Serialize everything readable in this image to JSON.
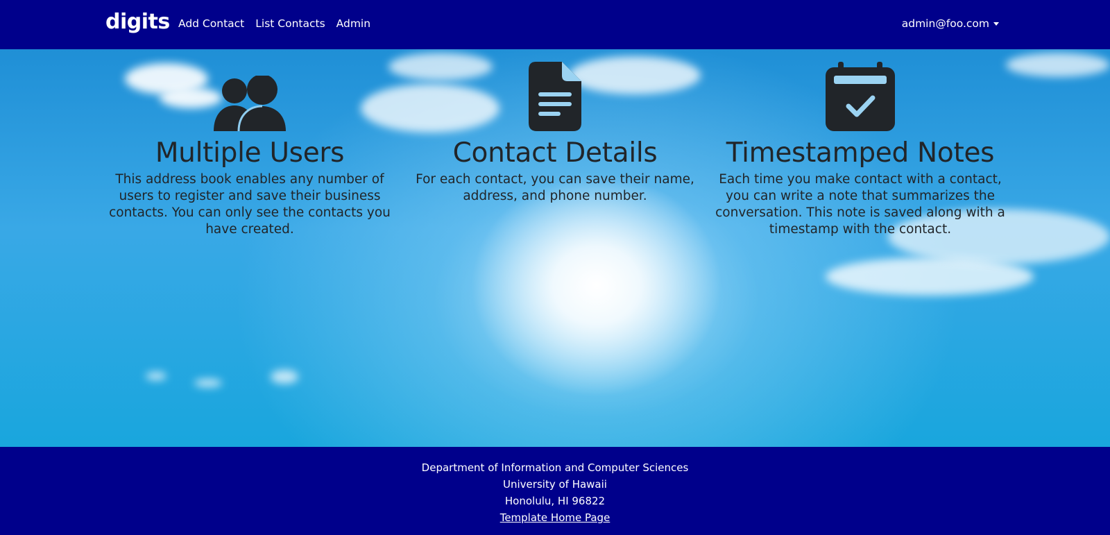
{
  "navbar": {
    "brand": "digits",
    "links": [
      "Add Contact",
      "List Contacts",
      "Admin"
    ],
    "user": "admin@foo.com"
  },
  "features": [
    {
      "icon": "users-icon",
      "title": "Multiple Users",
      "description": "This address book enables any number of users to register and save their business contacts. You can only see the contacts you have created."
    },
    {
      "icon": "file-text-icon",
      "title": "Contact Details",
      "description": "For each contact, you can save their name, address, and phone number."
    },
    {
      "icon": "calendar-check-icon",
      "title": "Timestamped Notes",
      "description": "Each time you make contact with a contact, you can write a note that summarizes the conversation. This note is saved along with a timestamp with the contact."
    }
  ],
  "footer": {
    "lines": [
      "Department of Information and Computer Sciences",
      "University of Hawaii",
      "Honolulu, HI 96822"
    ],
    "link": "Template Home Page"
  },
  "colors": {
    "navbar": "#00008b",
    "footer": "#00008b",
    "text_dark": "#212529",
    "sky": "#1f8fd6"
  }
}
